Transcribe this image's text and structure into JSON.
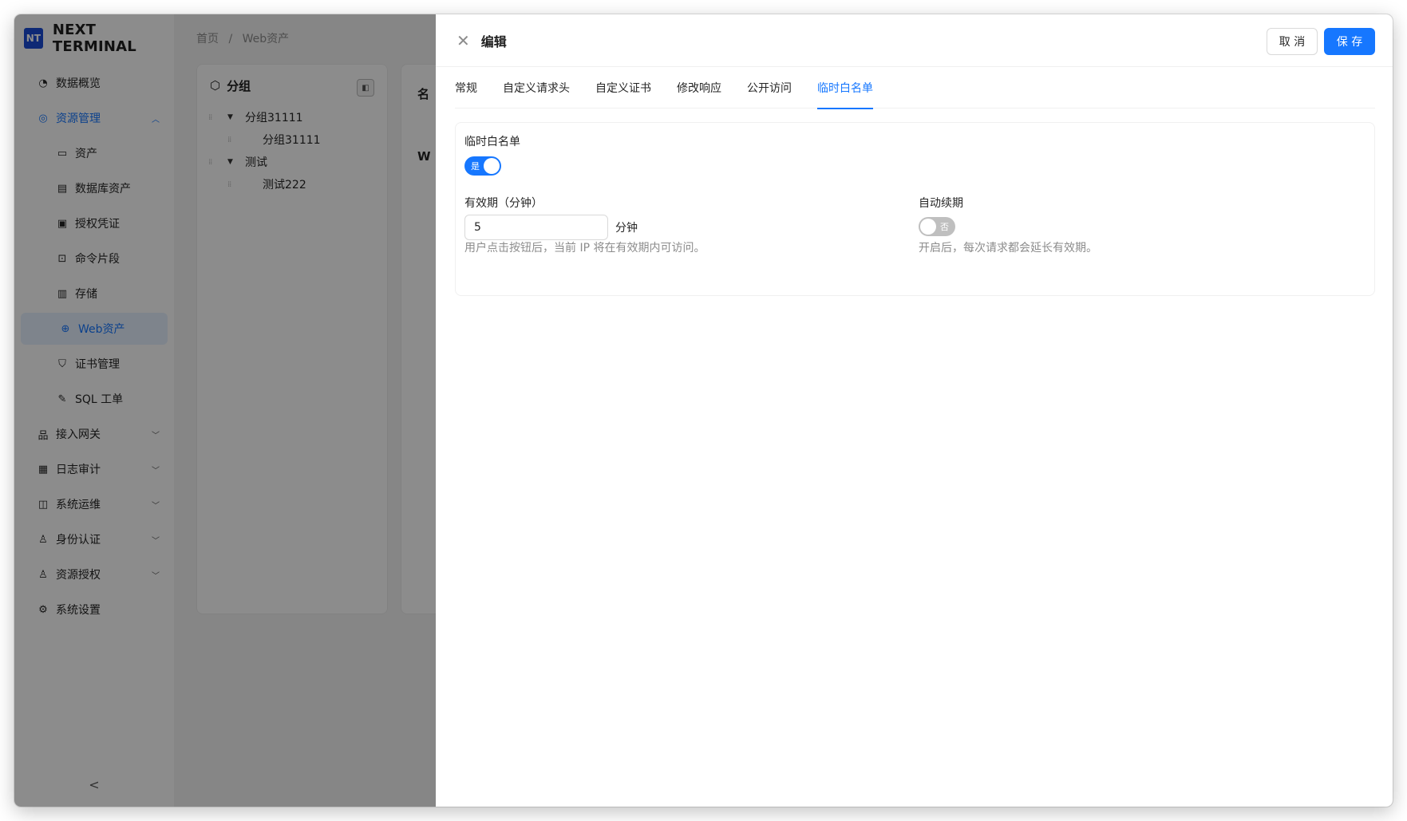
{
  "brand": {
    "logo": "NT",
    "name": "NEXT TERMINAL"
  },
  "sidebar": {
    "items": [
      {
        "label": "数据概览",
        "icon": "dashboard-icon"
      },
      {
        "label": "资源管理",
        "icon": "resource-icon",
        "expanded": true
      },
      {
        "label": "资产",
        "icon": "desktop-icon"
      },
      {
        "label": "数据库资产",
        "icon": "database-icon"
      },
      {
        "label": "授权凭证",
        "icon": "credential-icon"
      },
      {
        "label": "命令片段",
        "icon": "code-icon"
      },
      {
        "label": "存储",
        "icon": "storage-icon"
      },
      {
        "label": "Web资产",
        "icon": "globe-icon",
        "selected": true
      },
      {
        "label": "证书管理",
        "icon": "shield-icon"
      },
      {
        "label": "SQL 工单",
        "icon": "edit-icon"
      },
      {
        "label": "接入网关",
        "icon": "gateway-icon"
      },
      {
        "label": "日志审计",
        "icon": "audit-icon"
      },
      {
        "label": "系统运维",
        "icon": "ops-icon"
      },
      {
        "label": "身份认证",
        "icon": "user-icon"
      },
      {
        "label": "资源授权",
        "icon": "user-icon"
      },
      {
        "label": "系统设置",
        "icon": "gear-icon"
      }
    ],
    "collapse_icon": "<"
  },
  "breadcrumb": {
    "home": "首页",
    "sep": "/",
    "current": "Web资产"
  },
  "group_panel": {
    "title": "分组",
    "tree": [
      {
        "label": "分组31111",
        "children": [
          "分组31111"
        ]
      },
      {
        "label": "测试",
        "children": [
          "测试222"
        ]
      }
    ]
  },
  "list_panel": {
    "partial_letters": [
      "名",
      "W"
    ]
  },
  "drawer": {
    "title": "编辑",
    "cancel_label": "取 消",
    "save_label": "保 存",
    "tabs": [
      "常规",
      "自定义请求头",
      "自定义证书",
      "修改响应",
      "公开访问",
      "临时白名单"
    ],
    "active_tab": "临时白名单",
    "form": {
      "whitelist_label": "临时白名单",
      "whitelist_enabled": true,
      "whitelist_switch_text": "是",
      "validity_label": "有效期（分钟）",
      "validity_value": "5",
      "validity_suffix": "分钟",
      "validity_help": "用户点击按钮后，当前 IP 将在有效期内可访问。",
      "auto_renew_label": "自动续期",
      "auto_renew_enabled": false,
      "auto_renew_switch_text": "否",
      "auto_renew_help": "开启后，每次请求都会延长有效期。"
    }
  },
  "colors": {
    "primary": "#1677ff",
    "brand": "#1a4bd6"
  }
}
